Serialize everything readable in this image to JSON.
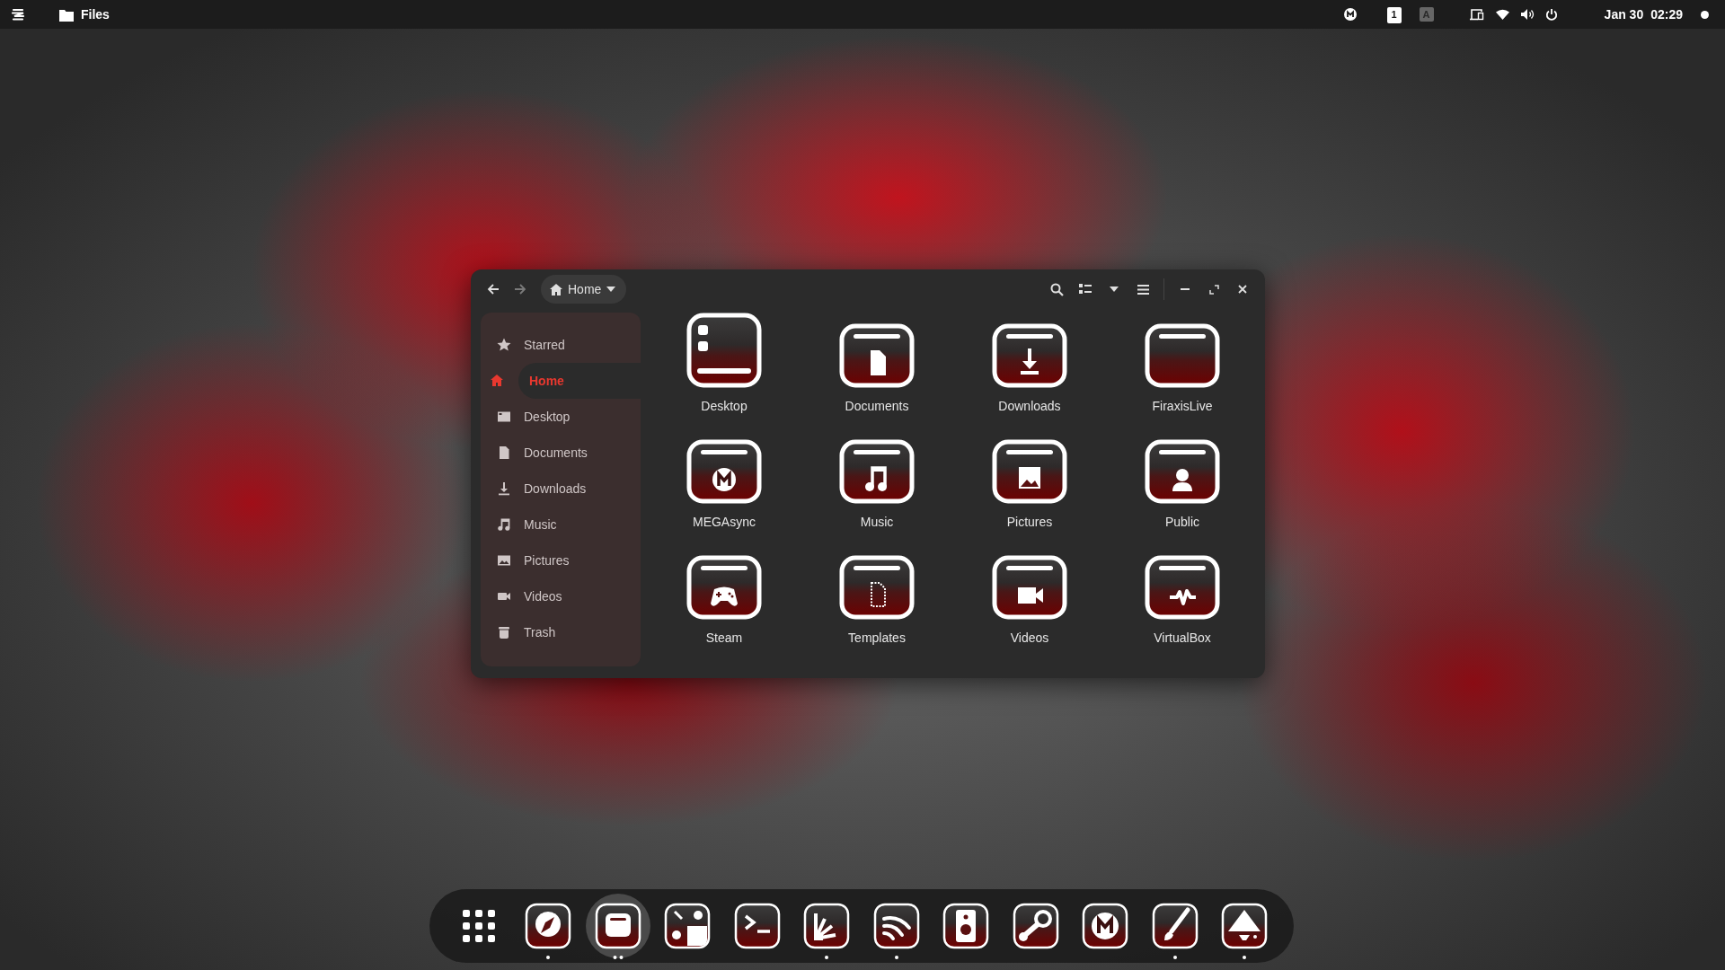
{
  "top_bar": {
    "app_name": "Files",
    "workspace": {
      "label": "1",
      "active": true
    },
    "input_source": {
      "label": "A",
      "active": false
    },
    "date": "Jan 30",
    "time": "02:29"
  },
  "window": {
    "navigation": [
      {
        "kind": "back",
        "disabled": false
      },
      {
        "kind": "forward",
        "disabled": true
      }
    ],
    "path": {
      "label": "Home"
    },
    "sidebar": [
      {
        "kind": "starred",
        "label": "Starred",
        "selected": false
      },
      {
        "kind": "home",
        "label": "Home",
        "selected": true
      },
      {
        "kind": "desktop",
        "label": "Desktop",
        "selected": false
      },
      {
        "kind": "documents",
        "label": "Documents",
        "selected": false
      },
      {
        "kind": "downloads",
        "label": "Downloads",
        "selected": false
      },
      {
        "kind": "music",
        "label": "Music",
        "selected": false
      },
      {
        "kind": "pictures",
        "label": "Pictures",
        "selected": false
      },
      {
        "kind": "videos",
        "label": "Videos",
        "selected": false
      },
      {
        "kind": "trash",
        "label": "Trash",
        "selected": false
      }
    ],
    "folders": [
      {
        "kind": "desktop",
        "label": "Desktop"
      },
      {
        "kind": "documents",
        "label": "Documents"
      },
      {
        "kind": "downloads",
        "label": "Downloads"
      },
      {
        "kind": "plain",
        "label": "FiraxisLive"
      },
      {
        "kind": "mega",
        "label": "MEGAsync"
      },
      {
        "kind": "music",
        "label": "Music"
      },
      {
        "kind": "pictures",
        "label": "Pictures"
      },
      {
        "kind": "public",
        "label": "Public"
      },
      {
        "kind": "games",
        "label": "Steam"
      },
      {
        "kind": "templates",
        "label": "Templates"
      },
      {
        "kind": "videos",
        "label": "Videos"
      },
      {
        "kind": "pulse",
        "label": "VirtualBox"
      }
    ]
  },
  "dock": [
    {
      "kind": "apps",
      "selected": false,
      "running": false,
      "multiple_windows": false
    },
    {
      "kind": "compass",
      "selected": false,
      "running": true,
      "multiple_windows": false
    },
    {
      "kind": "files",
      "selected": true,
      "running": true,
      "multiple_windows": true
    },
    {
      "kind": "tweaks",
      "selected": false,
      "running": false,
      "multiple_windows": false
    },
    {
      "kind": "terminal",
      "selected": false,
      "running": false,
      "multiple_windows": false
    },
    {
      "kind": "fan",
      "selected": false,
      "running": true,
      "multiple_windows": false
    },
    {
      "kind": "waves",
      "selected": false,
      "running": true,
      "multiple_windows": false
    },
    {
      "kind": "speaker",
      "selected": false,
      "running": false,
      "multiple_windows": false
    },
    {
      "kind": "steam",
      "selected": false,
      "running": false,
      "multiple_windows": false
    },
    {
      "kind": "mega",
      "selected": false,
      "running": false,
      "multiple_windows": false
    },
    {
      "kind": "brush",
      "selected": false,
      "running": true,
      "multiple_windows": false
    },
    {
      "kind": "inkscape",
      "selected": false,
      "running": true,
      "multiple_windows": false
    }
  ]
}
